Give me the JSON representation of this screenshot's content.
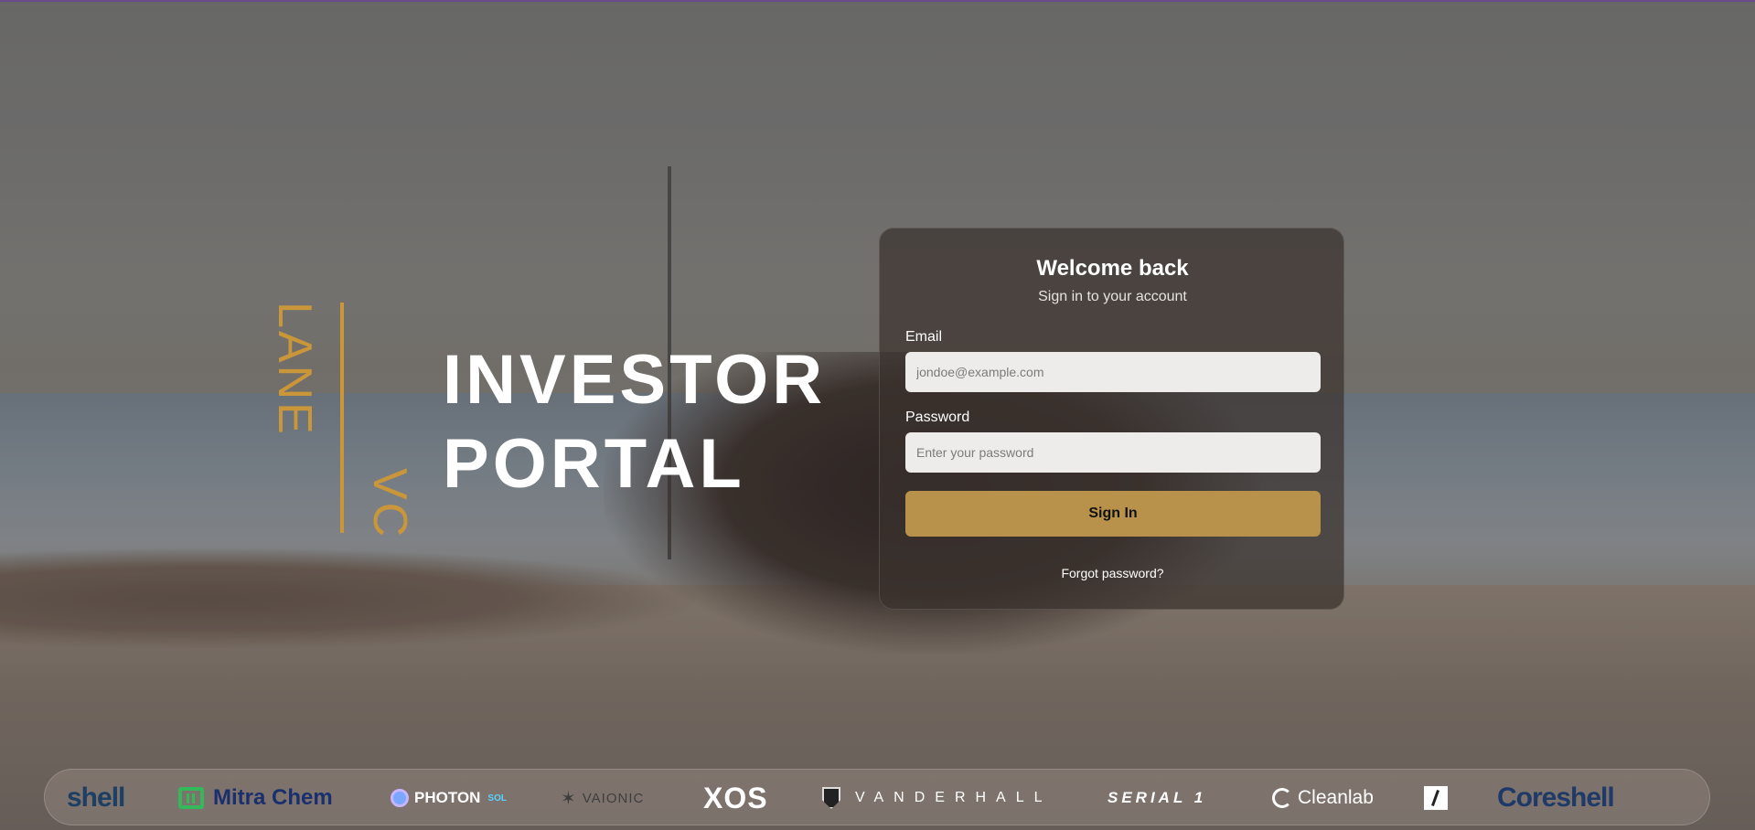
{
  "brand": {
    "word_top": "LANE",
    "word_bottom": "VC",
    "title_line1": "INVESTOR",
    "title_line2": "PORTAL",
    "accent_color": "#c9963a"
  },
  "login": {
    "heading": "Welcome back",
    "subheading": "Sign in to your account",
    "email_label": "Email",
    "email_placeholder": "jondoe@example.com",
    "password_label": "Password",
    "password_placeholder": "Enter your password",
    "submit_label": "Sign In",
    "submit_color": "#b8924a",
    "forgot_label": "Forgot password?"
  },
  "partners": {
    "shell": "shell",
    "mitra_chem": "Mitra Chem",
    "photon": "PHOTON",
    "photon_suffix": "SOL",
    "vaionic": "VAIONIC",
    "xos": "XOS",
    "vanderhall": "VANDERHALL",
    "serial1": "SERIAL 1",
    "cleanlab": "Cleanlab",
    "coreshell": "Coreshell"
  },
  "icons": {
    "mitra": "battery-icon",
    "photon": "photon-rocket-icon",
    "vaionic": "vaionic-star-icon",
    "vanderhall": "vanderhall-shield-icon",
    "cleanlab": "cleanlab-c-icon",
    "white_square": "slash-square-icon"
  }
}
